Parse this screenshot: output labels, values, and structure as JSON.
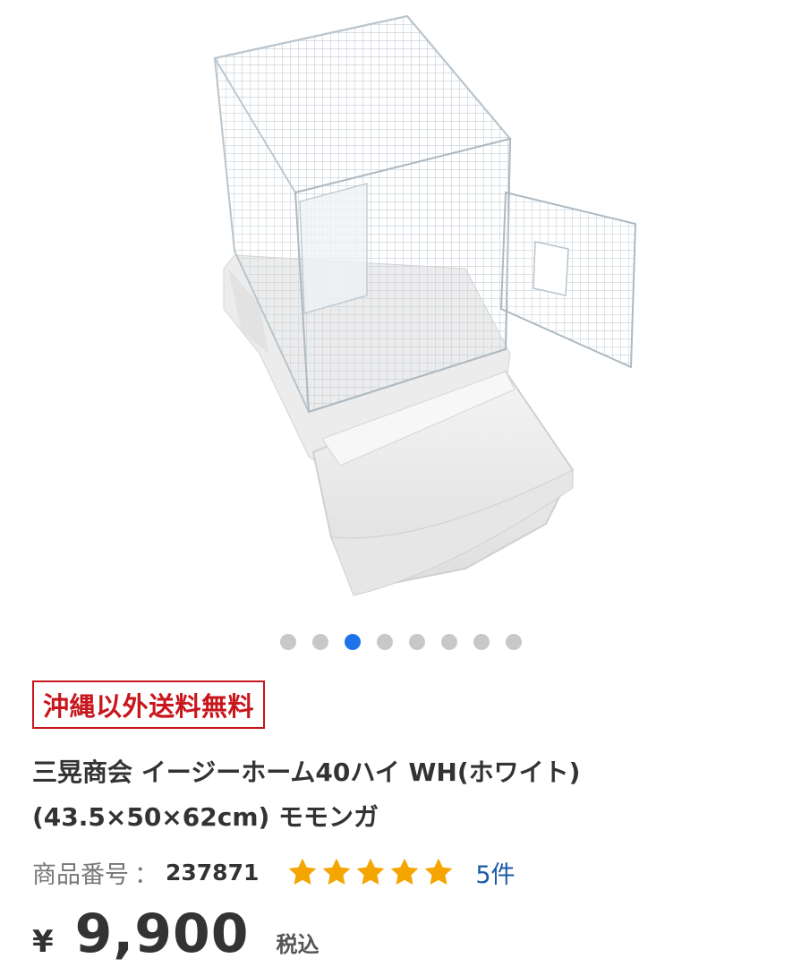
{
  "gallery": {
    "image_alt": "Bird cage product photo",
    "dots_total": 8,
    "active_index": 2,
    "colors": {
      "active": "#1e73e8",
      "inactive": "#c8c8c8"
    }
  },
  "badge": {
    "text": "沖縄以外送料無料",
    "color": "#c8161d"
  },
  "product": {
    "title": "三晃商会 イージーホーム40ハイ WH(ホワイト) (43.5×50×62cm) モモンガ",
    "item_number_label": "商品番号",
    "item_number_sep": "：",
    "item_number": "237871",
    "rating": 5,
    "review_count": "5件",
    "currency": "¥",
    "price": "9,900",
    "tax_label": "税込"
  }
}
